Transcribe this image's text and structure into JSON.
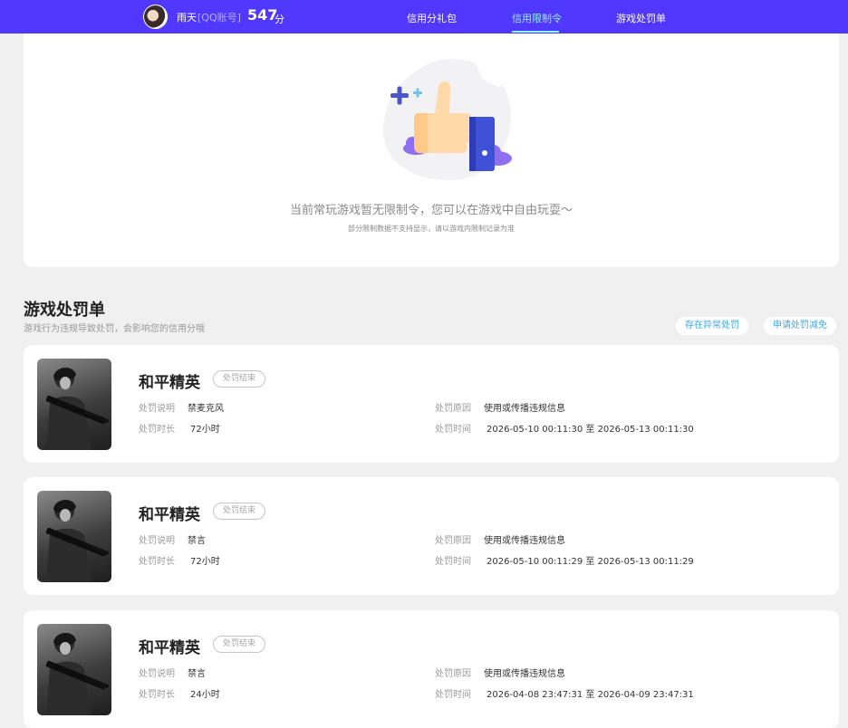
{
  "header": {
    "username": "雨天",
    "account_type": "[QQ账号]",
    "score": "547",
    "score_unit": "分",
    "nav": [
      "信用分礼包",
      "信用限制令",
      "游戏处罚单"
    ],
    "active_nav": "信用限制令"
  },
  "restriction": {
    "empty_message": "当前常玩游戏暂无限制令，您可以在游戏中自由玩耍～",
    "empty_note": "部分限制数据不支持显示，请以游戏内限制记录为准"
  },
  "penalties_section": {
    "title": "游戏处罚单",
    "subtitle": "游戏行为违规导致处罚，会影响您的信用分哦",
    "appeal_button": "存在异常处罚",
    "reduce_button": "申请处罚减免",
    "labels": {
      "desc": "处罚说明",
      "duration": "处罚时长",
      "reason": "处罚原因",
      "time": "处罚时间"
    },
    "items": [
      {
        "game": "和平精英",
        "status": "处罚结束",
        "desc": "禁麦克风",
        "duration": "72小时",
        "reason": "使用或传播违规信息",
        "time": "2026-05-10 00:11:30 至 2026-05-13 00:11:30"
      },
      {
        "game": "和平精英",
        "status": "处罚结束",
        "desc": "禁言",
        "duration": "72小时",
        "reason": "使用或传播违规信息",
        "time": "2026-05-10 00:11:29 至 2026-05-13 00:11:29"
      },
      {
        "game": "和平精英",
        "status": "处罚结束",
        "desc": "禁言",
        "duration": "24小时",
        "reason": "使用或传播违规信息",
        "time": "2026-04-08 23:47:31 至 2026-04-09 23:47:31"
      }
    ]
  },
  "colors": {
    "topbar": "#5038ff",
    "active_nav": "#8ff0ff",
    "link": "#3fa9e3"
  }
}
